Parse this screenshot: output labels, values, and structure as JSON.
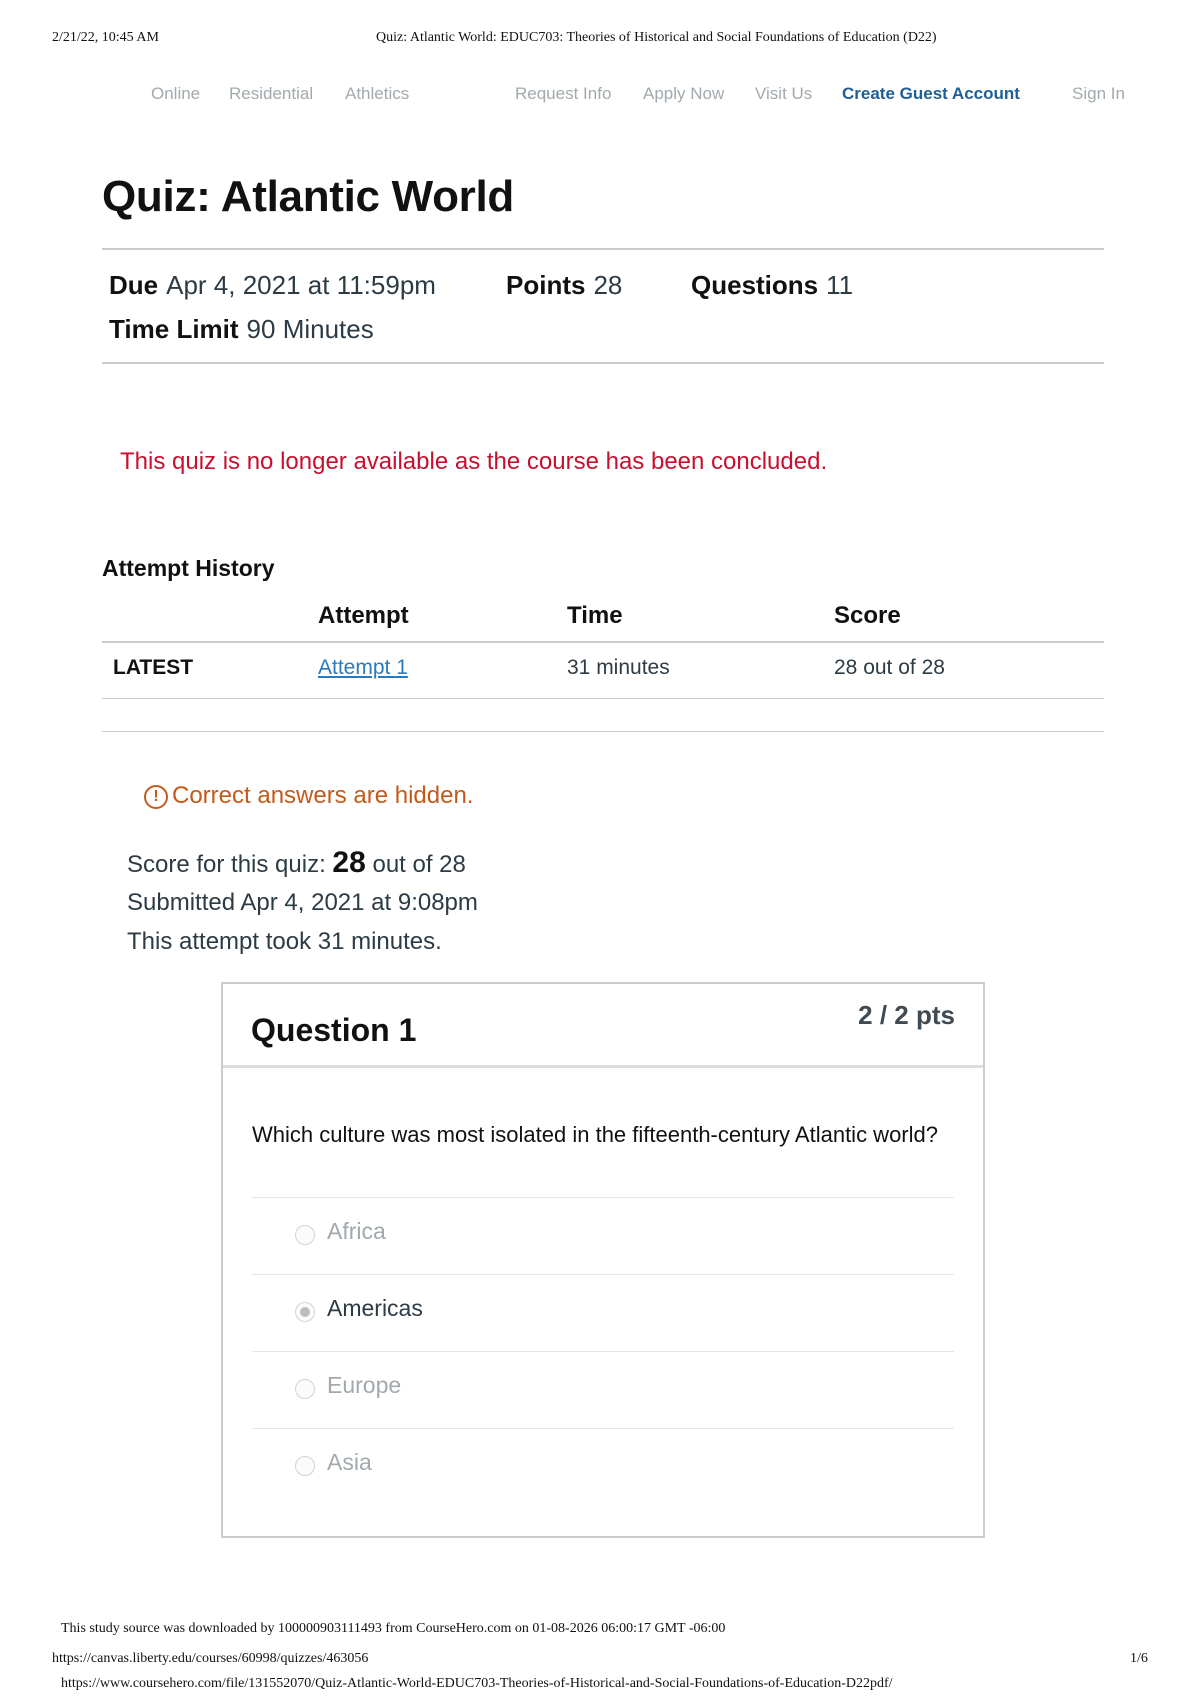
{
  "print_header": {
    "timestamp": "2/21/22, 10:45 AM",
    "document_title": "Quiz: Atlantic World: EDUC703: Theories of Historical and Social Foundations of Education (D22)"
  },
  "nav": {
    "items": [
      "Online",
      "Residential",
      "Athletics",
      "Request Info",
      "Apply Now",
      "Visit Us",
      "Create Guest Account",
      "Sign In"
    ]
  },
  "quiz": {
    "title": "Quiz: Atlantic World",
    "due_label": "Due",
    "due_value": "Apr 4, 2021 at 11:59pm",
    "points_label": "Points",
    "points_value": "28",
    "questions_label": "Questions",
    "questions_value": "11",
    "time_limit_label": "Time Limit",
    "time_limit_value": "90 Minutes",
    "concluded_message": "This quiz is no longer available as the course has been concluded."
  },
  "attempt_history": {
    "title": "Attempt History",
    "headers": [
      "Attempt",
      "Time",
      "Score"
    ],
    "rows": [
      {
        "tag": "LATEST",
        "attempt": "Attempt 1",
        "time": "31 minutes",
        "score": "28 out of 28"
      }
    ]
  },
  "results": {
    "hidden_notice": "Correct answers are hidden.",
    "warning_icon": "!",
    "score_prefix": "Score for this quiz:",
    "score_value": "28",
    "score_suffix": "out of 28",
    "submitted": "Submitted Apr 4, 2021 at 9:08pm",
    "duration": "This attempt took 31 minutes."
  },
  "question": {
    "title": "Question 1",
    "points": "2 / 2 pts",
    "text": "Which culture was most isolated in the fifteenth-century Atlantic world?",
    "answers": [
      "Africa",
      "Americas",
      "Europe",
      "Asia"
    ],
    "selected_answer": "Americas"
  },
  "footer": {
    "source_note": "This study source was downloaded by 100000903111493 from CourseHero.com on 01-08-2026 06:00:17 GMT -06:00",
    "canvas_url": "https://canvas.liberty.edu/courses/60998/quizzes/463056",
    "page_number": "1/6",
    "coursehero_url": "https://www.coursehero.com/file/131552070/Quiz-Atlantic-World-EDUC703-Theories-of-Historical-and-Social-Foundations-of-Education-D22pdf/"
  },
  "colors": {
    "error_red": "#c8102e",
    "warning_orange": "#c4591a",
    "link_blue": "#2b7abc",
    "nav_blue": "#1f5f96"
  }
}
